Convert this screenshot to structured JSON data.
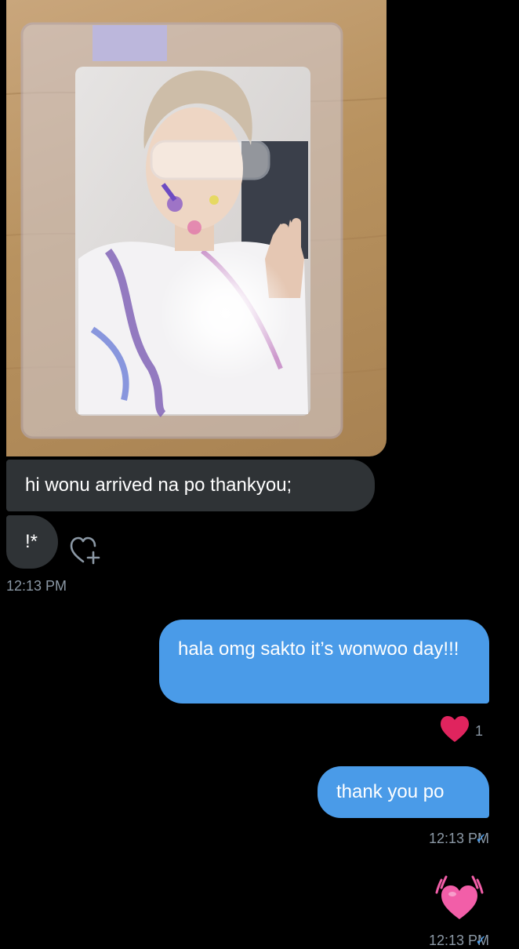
{
  "messages": {
    "received": [
      {
        "type": "photo",
        "icon": "photocard-image"
      },
      {
        "type": "text",
        "text": "hi wonu arrived na po thankyou;"
      },
      {
        "type": "text",
        "text": "!*"
      }
    ],
    "received_time": "12:13 PM",
    "sent": [
      {
        "type": "text",
        "text": "hala omg sakto it’s wonwoo day!!!",
        "reaction_count": "1"
      },
      {
        "type": "text",
        "text": "thank you po",
        "time": "12:13 PM",
        "status": "✓"
      },
      {
        "type": "emoji",
        "icon": "beating-heart-emoji",
        "time": "12:13 PM",
        "status": "✓"
      }
    ]
  },
  "colors": {
    "background": "#000000",
    "received_bubble": "#2f3336",
    "sent_bubble": "#4a9be8",
    "timestamp": "#8b98a5",
    "reaction_heart": "#e0245e"
  }
}
